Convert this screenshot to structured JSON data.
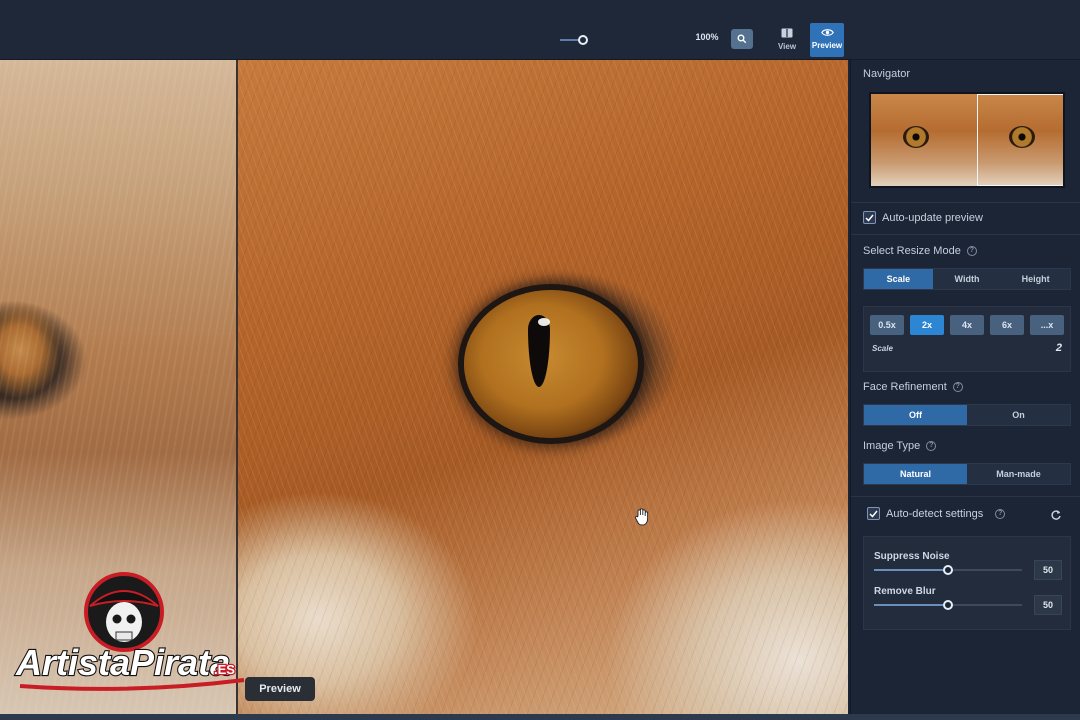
{
  "toolbar": {
    "zoom_level": "100%",
    "zoom_slider_value": 1.0,
    "view_label": "View",
    "preview_label": "Preview",
    "zoom_icon": "magnify-icon",
    "view_icon": "split-view-icon",
    "preview_icon": "eye-icon"
  },
  "canvas": {
    "preview_button": "Preview",
    "cursor_icon": "hand-grab-icon"
  },
  "watermark": {
    "brand_a": "Artista",
    "brand_b": "Pirata",
    "brand_tld": ".ES",
    "icon": "pirate-skull-logo"
  },
  "panel": {
    "navigator_title": "Navigator",
    "auto_update": {
      "label": "Auto-update preview",
      "checked": true
    },
    "resize_mode": {
      "title": "Select Resize Mode",
      "options": [
        "Scale",
        "Width",
        "Height"
      ],
      "selected": "Scale"
    },
    "scale": {
      "options": [
        "0.5x",
        "2x",
        "4x",
        "6x",
        "...x"
      ],
      "selected": "2x",
      "label": "Scale",
      "value": "2"
    },
    "face_refinement": {
      "title": "Face Refinement",
      "options": [
        "Off",
        "On"
      ],
      "selected": "Off"
    },
    "image_type": {
      "title": "Image Type",
      "options": [
        "Natural",
        "Man-made"
      ],
      "selected": "Natural"
    },
    "auto_detect": {
      "label": "Auto-detect settings",
      "checked": true
    },
    "suppress_noise": {
      "label": "Suppress Noise",
      "value": "50",
      "level": 0.5
    },
    "remove_blur": {
      "label": "Remove Blur",
      "value": "50",
      "level": 0.5
    }
  },
  "colors": {
    "accent": "#2f6aa7",
    "accent_bright": "#2d86d4",
    "panel_bg": "#1c2535",
    "toolbar_bg": "#1e2838"
  }
}
